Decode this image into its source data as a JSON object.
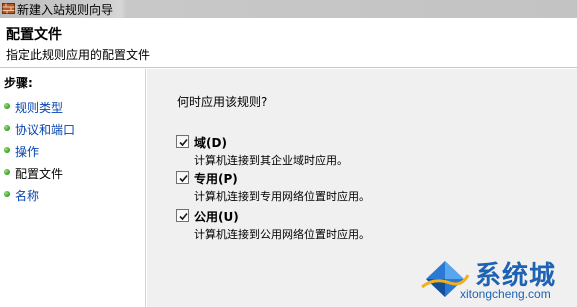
{
  "window": {
    "title": "新建入站规则向导",
    "icon": "firewall-rule-icon"
  },
  "header": {
    "title": "配置文件",
    "subtitle": "指定此规则应用的配置文件"
  },
  "sidebar": {
    "steps_label": "步骤:",
    "items": [
      {
        "label": "规则类型",
        "current": false
      },
      {
        "label": "协议和端口",
        "current": false
      },
      {
        "label": "操作",
        "current": false
      },
      {
        "label": "配置文件",
        "current": true
      },
      {
        "label": "名称",
        "current": false
      }
    ]
  },
  "main": {
    "question": "何时应用该规则?",
    "options": [
      {
        "label": "域(D)",
        "description": "计算机连接到其企业域时应用。",
        "checked": true
      },
      {
        "label": "专用(P)",
        "description": "计算机连接到专用网络位置时应用。",
        "checked": true
      },
      {
        "label": "公用(U)",
        "description": "计算机连接到公用网络位置时应用。",
        "checked": true
      }
    ]
  },
  "watermark": {
    "brand": "系统城",
    "url": "xitongcheng.com"
  },
  "colors": {
    "link": "#0645ad",
    "main_bg": "#f0f0f0",
    "step_dot": "#3fa82a",
    "watermark": "#1e62b3"
  }
}
